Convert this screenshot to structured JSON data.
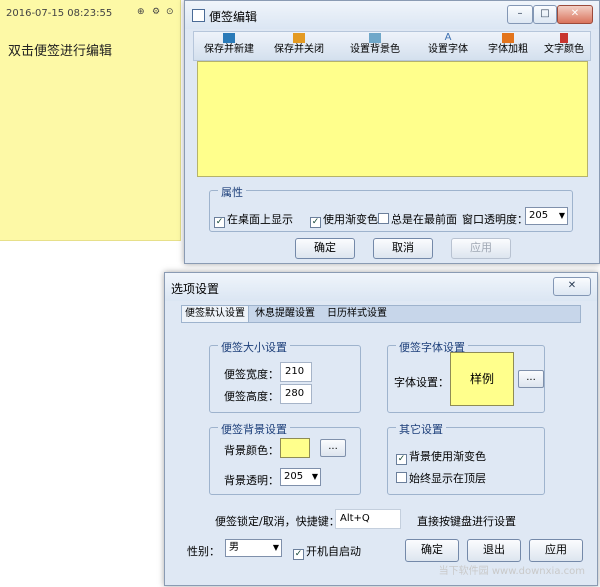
{
  "note": {
    "timestamp": "2016-07-15 08:23:55",
    "hint": "双击便签进行编辑",
    "controls": [
      "⊕",
      "⚙",
      "⊙"
    ]
  },
  "editor": {
    "title": "便签编辑",
    "toolbar": [
      {
        "label": "保存并新建",
        "icon": "save-new-icon"
      },
      {
        "label": "保存并关闭",
        "icon": "save-close-icon"
      },
      {
        "label": "设置背景色",
        "icon": "background-color-icon"
      },
      {
        "label": "设置字体",
        "icon": "font-icon"
      },
      {
        "label": "字体加粗",
        "icon": "bold-icon"
      },
      {
        "label": "文字颜色",
        "icon": "text-color-icon"
      }
    ],
    "properties": {
      "title": "属性",
      "show_on_desktop": "在桌面上显示",
      "use_gradient": "使用渐变色",
      "always_front": "总是在最前面",
      "opacity_label": "窗口透明度：",
      "opacity_value": "205"
    },
    "ok": "确定",
    "cancel": "取消",
    "apply": "应用"
  },
  "options": {
    "title": "选项设置",
    "close": "✕",
    "tabs": [
      "便签默认设置",
      "休息提醒设置",
      "日历样式设置"
    ],
    "size_group": {
      "title": "便签大小设置",
      "width_label": "便签宽度：",
      "width_value": "210",
      "height_label": "便签高度：",
      "height_value": "280"
    },
    "font_group": {
      "title": "便签字体设置",
      "font_label": "字体设置：",
      "sample": "样例",
      "browse": "..."
    },
    "bg_group": {
      "title": "便签背景设置",
      "color_label": "背景颜色：",
      "browse": "...",
      "opacity_label": "背景透明：",
      "opacity_value": "205"
    },
    "other_group": {
      "title": "其它设置",
      "use_gradient": "背景使用渐变色",
      "always_top": "始终显示在顶层"
    },
    "hotkey_label": "便签锁定/取消，快捷键：",
    "hotkey_value": "Alt+Q",
    "hotkey_hint": "直接按键盘进行设置",
    "gender_label": "性别：",
    "gender_value": "男",
    "autostart": "开机自启动",
    "ok": "确定",
    "exit": "退出",
    "apply": "应用"
  },
  "watermark": "当下软件园 www.downxia.com"
}
